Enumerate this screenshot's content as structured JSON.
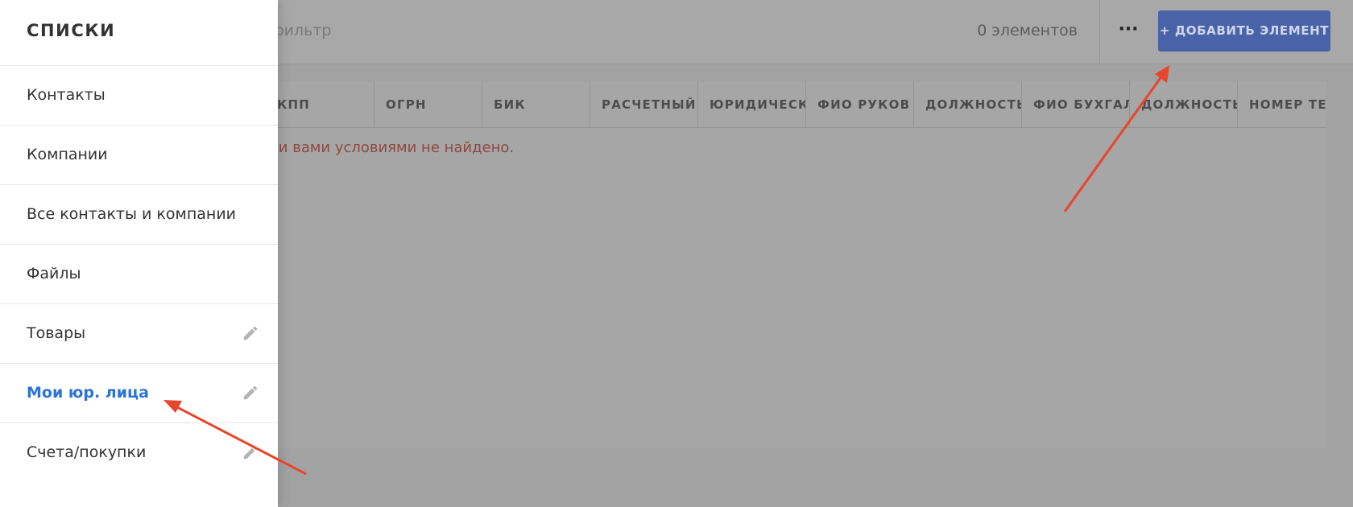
{
  "topbar": {
    "filter_text": "и фильтр",
    "count_text": "0 элементов",
    "more_label": "···",
    "add_button_label": "+ ДОБАВИТЬ ЭЛЕМЕНТ"
  },
  "table": {
    "columns": [
      "КПП",
      "ОГРН",
      "БИК",
      "РАСЧЕТНЫЙ",
      "ЮРИДИЧЕСК",
      "ФИО РУКОВ",
      "ДОЛЖНОСТЬ",
      "ФИО БУХГАЛ",
      "ДОЛЖНОСТЬ",
      "НОМЕР ТЕЛ"
    ],
    "empty_message": "ыми вами условиями не найдено."
  },
  "panel": {
    "title": "СПИСКИ",
    "items": [
      {
        "label": "Контакты",
        "editable": false,
        "active": false
      },
      {
        "label": "Компании",
        "editable": false,
        "active": false
      },
      {
        "label": "Все контакты и компании",
        "editable": false,
        "active": false
      },
      {
        "label": "Файлы",
        "editable": false,
        "active": false
      },
      {
        "label": "Товары",
        "editable": true,
        "active": false
      },
      {
        "label": "Мои юр. лица",
        "editable": true,
        "active": true
      },
      {
        "label": "Счета/покупки",
        "editable": true,
        "active": false
      }
    ]
  },
  "colors": {
    "accent": "#2d73d6",
    "add_button": "#4a62a8",
    "annotation_arrow": "#e8452c"
  },
  "icons": {
    "edit": "pencil-icon",
    "more": "more-dots-icon"
  }
}
